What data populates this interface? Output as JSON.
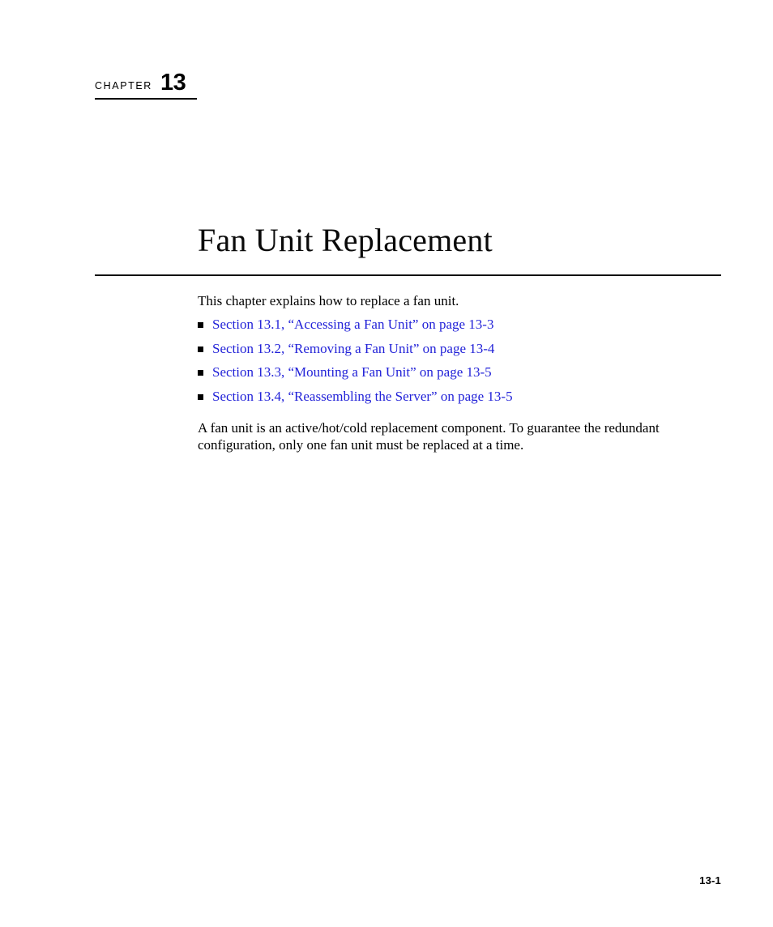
{
  "chapter": {
    "label": "CHAPTER",
    "number": "13",
    "title": "Fan Unit Replacement"
  },
  "body": {
    "intro": "This chapter explains how to replace a fan unit.",
    "links": [
      {
        "text": "Section 13.1, “Accessing a Fan Unit” on page 13-3"
      },
      {
        "text": "Section 13.2, “Removing a Fan Unit” on page 13-4"
      },
      {
        "text": "Section 13.3, “Mounting a Fan Unit” on page 13-5"
      },
      {
        "text": "Section 13.4, “Reassembling the Server” on page 13-5"
      }
    ],
    "closing": "A fan unit is an active/hot/cold replacement component. To guarantee the redundant configuration, only one fan unit must be replaced at a time."
  },
  "footer": {
    "page_number": "13-1"
  },
  "colors": {
    "text": "#000000",
    "link": "#2222d8",
    "rule": "#000000",
    "background": "#ffffff"
  }
}
